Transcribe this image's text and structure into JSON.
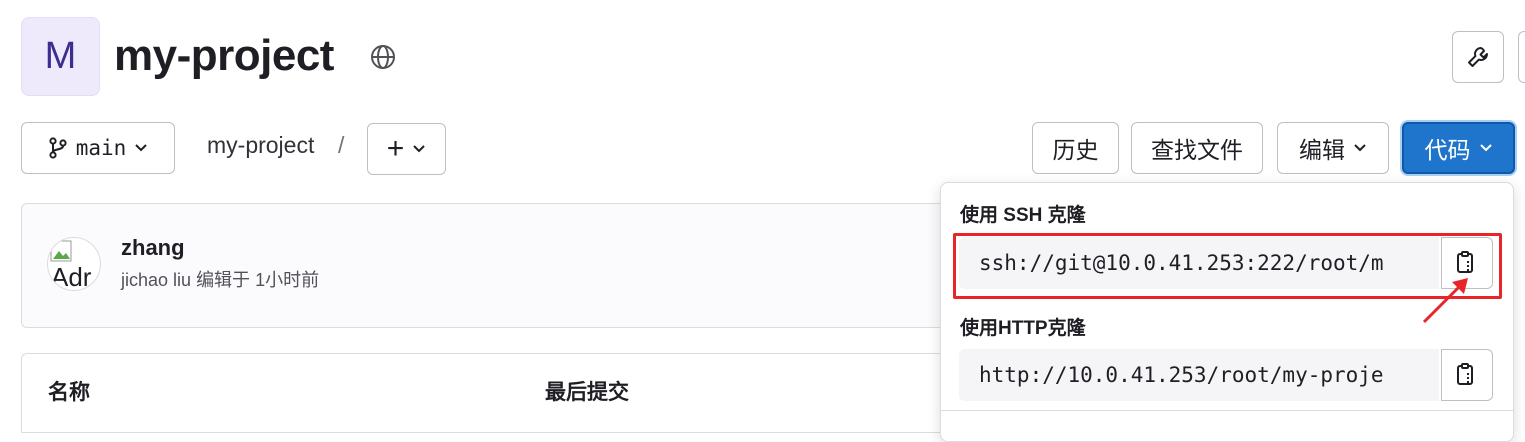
{
  "project": {
    "avatar_letter": "M",
    "name": "my-project"
  },
  "toolbar": {
    "branch": "main",
    "breadcrumb_project": "my-project",
    "breadcrumb_sep": "/",
    "add_symbol": "+",
    "history_label": "历史",
    "find_file_label": "查找文件",
    "edit_label": "编辑",
    "code_label": "代码"
  },
  "commit": {
    "title": "zhang",
    "avatar_alt": "Adr",
    "author": "jichao liu",
    "meta_suffix": "编辑于 1小时前"
  },
  "file_table": {
    "columns": [
      "名称",
      "最后提交"
    ]
  },
  "clone_dropdown": {
    "ssh_label": "使用 SSH 克隆",
    "ssh_url": "ssh://git@10.0.41.253:222/root/m",
    "http_label": "使用HTTP克隆",
    "http_url": "http://10.0.41.253/root/my-proje"
  },
  "colors": {
    "primary": "#1f75cb",
    "highlight": "#e8262a",
    "avatar_bg": "#eeeafc"
  },
  "icons": [
    "globe-icon",
    "wrench-icon",
    "branch-icon",
    "chevron-down-icon",
    "plus-icon",
    "copy-icon"
  ]
}
